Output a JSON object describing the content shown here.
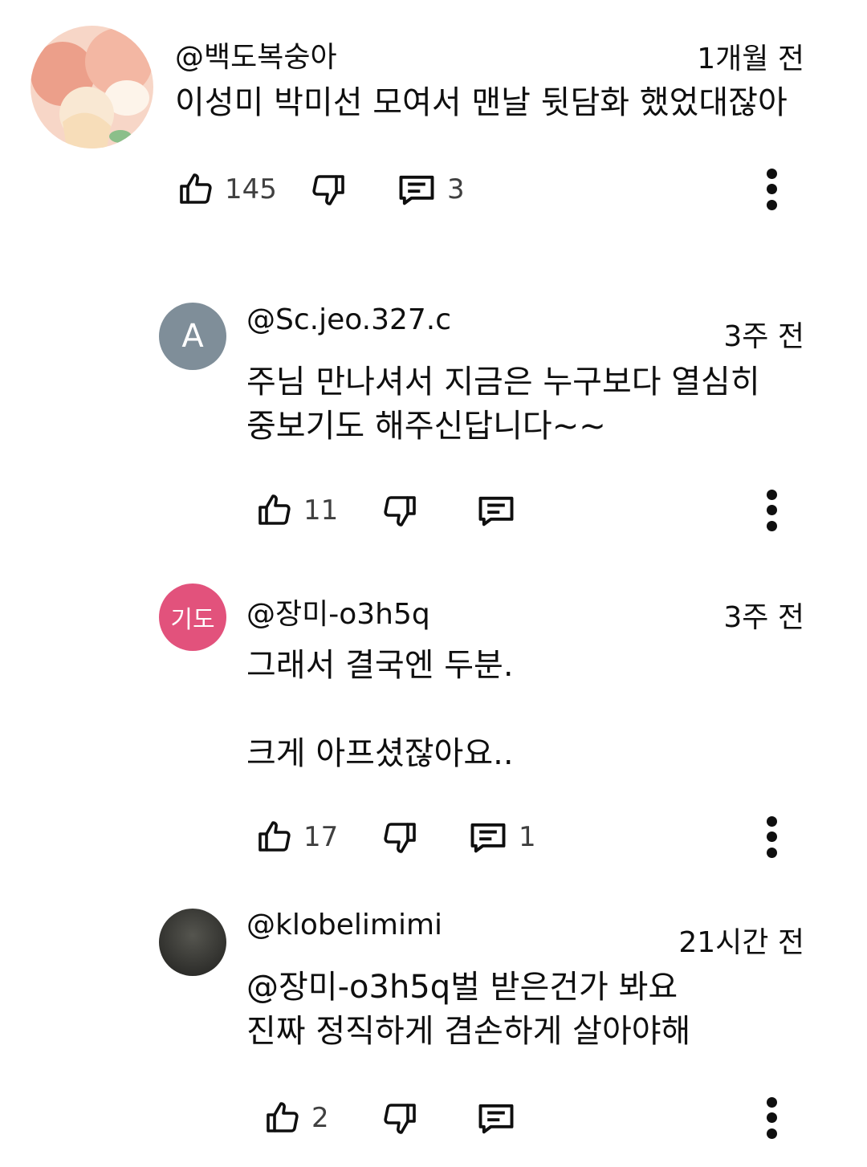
{
  "comments": [
    {
      "author": "@백도복숭아",
      "time": "1개월 전",
      "text": "이성미 박미선 모여서 맨날 뒷담화 했었대잖아",
      "likes": "145",
      "replies": "3",
      "avatar": {
        "type": "photo",
        "colors": [
          "#f6c9b8",
          "#e9a08c",
          "#fdf1e4"
        ]
      }
    },
    {
      "author": "@Sc.jeo.327.c",
      "time": "3주 전",
      "text": "주님 만나셔서 지금은  누구보다 열심히\n중보기도 해주신답니다~~",
      "likes": "11",
      "replies": "",
      "avatar": {
        "type": "letter",
        "label": "A",
        "color": "#7f8e99"
      }
    },
    {
      "author": "@장미-o3h5q",
      "time": "3주 전",
      "text": "그래서 결국엔 두분.\n\n크게 아프셨잖아요..",
      "likes": "17",
      "replies": "1",
      "avatar": {
        "type": "letter",
        "label": "기도",
        "color": "#e2527c"
      }
    },
    {
      "author": "@klobelimimi",
      "time": "21시간 전",
      "text": "@장미-o3h5q벌 받은건가 봐요\n진짜 정직하게 겸손하게 살아야해",
      "likes": "2",
      "replies": "",
      "avatar": {
        "type": "photo",
        "colors": [
          "#3a3a36",
          "#4d4d48",
          "#2a2a27"
        ]
      }
    }
  ],
  "icons": {
    "like": "thumbs-up-icon",
    "dislike": "thumbs-down-icon",
    "reply": "comment-icon",
    "more": "more-vertical-icon"
  }
}
